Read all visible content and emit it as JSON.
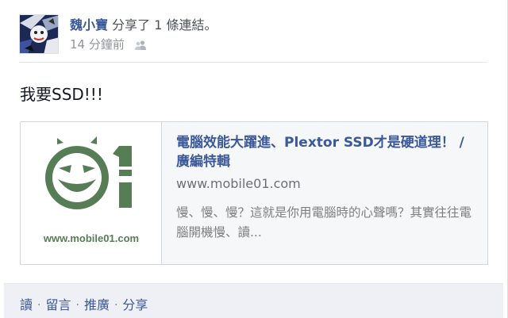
{
  "post": {
    "author": "魏小寶",
    "action": "分享了 1 條連結。",
    "timestamp": "14 分鐘前",
    "audience_icon": "friends-icon",
    "status_text": "我要SSD!!!",
    "link": {
      "title": "電腦效能大躍進、Plextor SSD才是硬道理！ / 廣編特輯",
      "domain": "www.mobile01.com",
      "description": "慢、慢、慢？這就是你用電腦時的心聲嗎？其實往往電腦開機慢、讀...",
      "thumbnail_caption": "www.mobile01.com",
      "thumbnail_icon": "mobile01-logo",
      "logo_color": "#567d55"
    },
    "actions": {
      "read": "讀",
      "comment": "留言",
      "like": "推廣",
      "share": "分享",
      "separator": "·"
    },
    "colors": {
      "link_blue": "#3b5998",
      "action_bar_bg": "#eef0f5",
      "link_card_bg": "#f6f7f9"
    }
  }
}
